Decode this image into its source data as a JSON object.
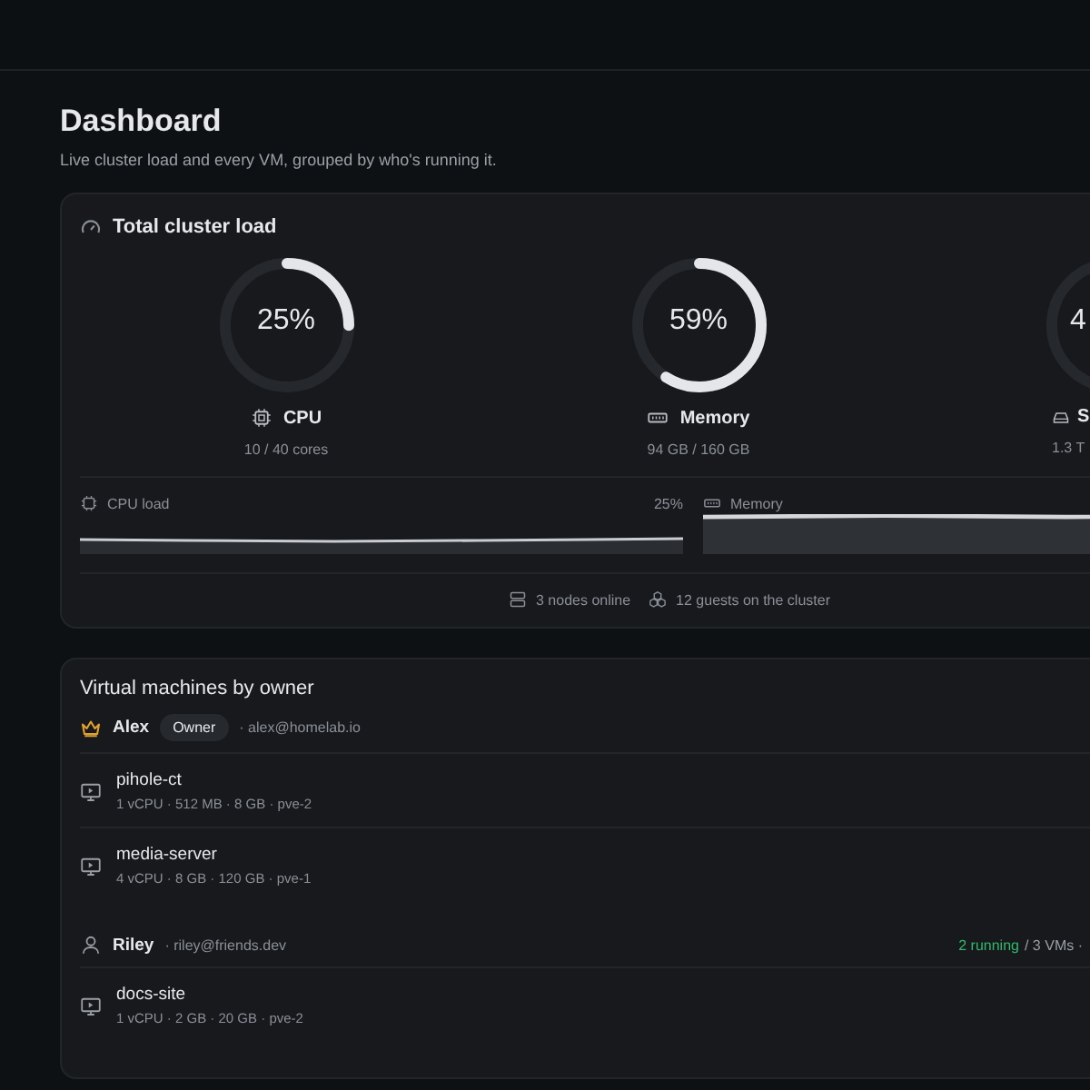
{
  "header": {
    "title": "Dashboard",
    "subtitle": "Live cluster load and every VM, grouped by who's running it."
  },
  "cluster": {
    "title": "Total cluster load",
    "gauges": [
      {
        "kind": "cpu",
        "value": "25%",
        "level": 0.25,
        "label": "CPU",
        "detail": "10 / 40 cores"
      },
      {
        "kind": "memory",
        "value": "59%",
        "level": 0.59,
        "label": "Memory",
        "detail": "94 GB / 160 GB"
      },
      {
        "kind": "storage",
        "value": "4",
        "label": "S",
        "detail": "1.3 T"
      }
    ],
    "trends": [
      {
        "kind": "cpu",
        "label": "CPU load",
        "reading": "25%"
      },
      {
        "kind": "memory",
        "label": "Memory"
      }
    ],
    "footer": [
      {
        "kind": "nodes",
        "text": "3 nodes online"
      },
      {
        "kind": "guests",
        "text": "12 guests on the cluster"
      }
    ]
  },
  "vms": {
    "title": "Virtual machines by owner",
    "owners": [
      {
        "kind": "owner",
        "name": "Alex",
        "badge": "Owner",
        "email": "· alex@homelab.io",
        "machines": [
          {
            "name": "pihole-ct",
            "specs": "1 vCPU · 512 MB · 8 GB · pve-2"
          },
          {
            "name": "media-server",
            "specs": "4 vCPU · 8 GB · 120 GB · pve-1"
          }
        ]
      },
      {
        "kind": "user",
        "name": "Riley",
        "email": "· riley@friends.dev",
        "running": "2 running",
        "total": "/ 3 VMs ·",
        "machines": [
          {
            "name": "docs-site",
            "specs": "1 vCPU · 2 GB · 20 GB · pve-2"
          }
        ]
      }
    ]
  }
}
